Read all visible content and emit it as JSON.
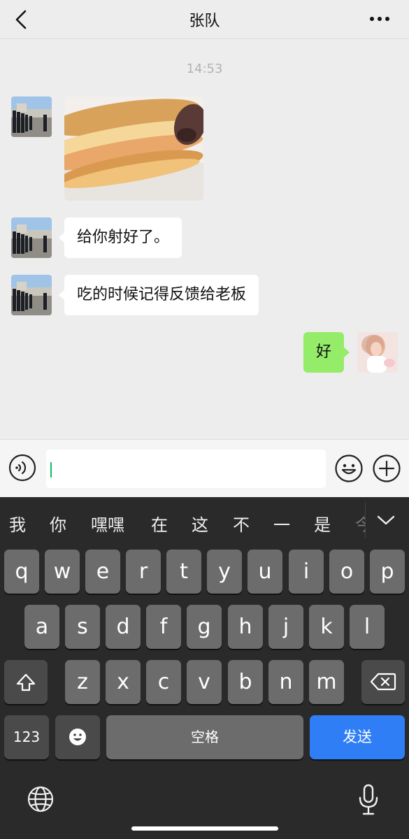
{
  "header": {
    "title": "张队"
  },
  "chat": {
    "timestamp": "14:53",
    "messages": [
      {
        "side": "left",
        "type": "image"
      },
      {
        "side": "left",
        "type": "text",
        "text": "给你射好了。"
      },
      {
        "side": "left",
        "type": "text",
        "text": "吃的时候记得反馈给老板"
      },
      {
        "side": "right",
        "type": "text",
        "text": "好"
      }
    ]
  },
  "input": {
    "value": ""
  },
  "keyboard": {
    "candidates": [
      "我",
      "你",
      "嘿嘿",
      "在",
      "这",
      "不",
      "一",
      "是",
      "今"
    ],
    "row1": [
      "q",
      "w",
      "e",
      "r",
      "t",
      "y",
      "u",
      "i",
      "o",
      "p"
    ],
    "row2": [
      "a",
      "s",
      "d",
      "f",
      "g",
      "h",
      "j",
      "k",
      "l"
    ],
    "row3": [
      "z",
      "x",
      "c",
      "v",
      "b",
      "n",
      "m"
    ],
    "numbers_label": "123",
    "space_label": "空格",
    "send_label": "发送"
  },
  "colors": {
    "sent_bubble": "#95ec69",
    "received_bubble": "#ffffff",
    "send_key": "#2f7ef6",
    "caret": "#07c160"
  }
}
